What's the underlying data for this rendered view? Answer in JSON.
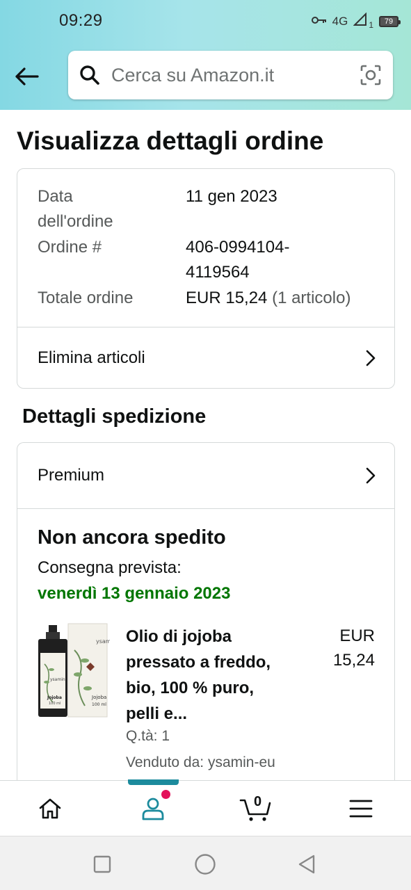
{
  "status_bar": {
    "time": "09:29",
    "network": "4G",
    "sim": "1",
    "battery": "79"
  },
  "search": {
    "placeholder": "Cerca su Amazon.it"
  },
  "page": {
    "title": "Visualizza dettagli ordine"
  },
  "order": {
    "date_label_1": "Data",
    "date_label_2": "dell'ordine",
    "date_value": "11 gen 2023",
    "number_label": "Ordine #",
    "number_value_1": "406-0994104-",
    "number_value_2": "4119564",
    "total_label": "Totale ordine",
    "total_value": "EUR 15,24",
    "total_items": "(1 articolo)",
    "remove_items": "Elimina articoli"
  },
  "shipping": {
    "section_title": "Dettagli spedizione",
    "method": "Premium",
    "status": "Non ancora spedito",
    "delivery_label": "Consegna prevista:",
    "delivery_date": "venerdì 13 gennaio 2023",
    "product": {
      "title_lines": [
        "Olio di jojoba",
        "pressato a freddo,",
        "bio, 100 % puro,",
        "pelli e..."
      ],
      "price_currency": "EUR",
      "price_value": "15,24",
      "quantity": "Q.tà: 1",
      "seller": "Venduto da: ysamin-eu",
      "image_brand": "ysamin",
      "image_label": "Jojoba",
      "image_volume": "100 ml"
    }
  },
  "bottom_nav": {
    "cart_count": "0"
  },
  "colors": {
    "accent": "#1c8b9d",
    "badge": "#e3125b",
    "delivery": "#007600"
  }
}
